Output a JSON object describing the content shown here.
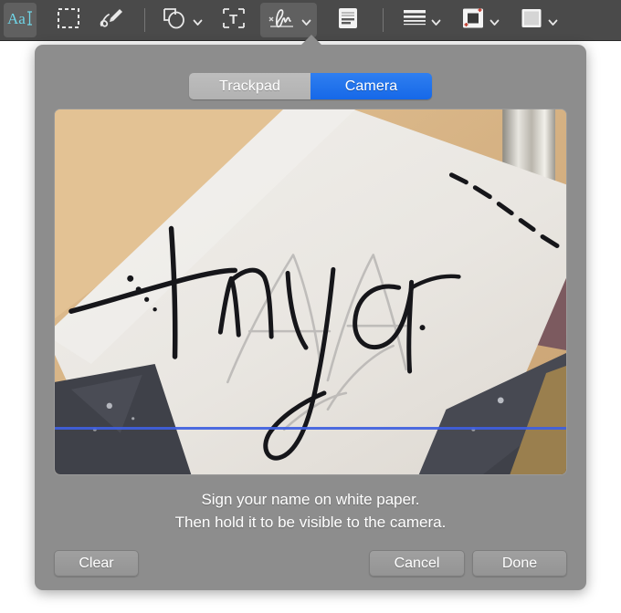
{
  "toolbar": {
    "items": [
      {
        "name": "text-selection-tool",
        "icon": "text-selection-icon",
        "label": "Aa",
        "active": true,
        "chevron": false
      },
      {
        "name": "rect-selection-tool",
        "icon": "marquee-selection-icon",
        "label": "",
        "active": false,
        "chevron": false
      },
      {
        "name": "sketch-tool",
        "icon": "sketch-pen-icon",
        "label": "",
        "active": false,
        "chevron": false
      },
      {
        "name": "shapes-tool",
        "icon": "shapes-icon",
        "label": "",
        "active": false,
        "chevron": true
      },
      {
        "name": "text-tool",
        "icon": "text-box-icon",
        "label": "",
        "active": false,
        "chevron": false
      },
      {
        "name": "signature-tool",
        "icon": "signature-icon",
        "label": "",
        "active": true,
        "chevron": true
      },
      {
        "name": "note-tool",
        "icon": "note-icon",
        "label": "",
        "active": false,
        "chevron": false
      },
      {
        "name": "stroke-weight-tool",
        "icon": "stroke-weight-icon",
        "label": "",
        "active": false,
        "chevron": true
      },
      {
        "name": "border-color-tool",
        "icon": "border-color-icon",
        "label": "",
        "active": false,
        "chevron": true
      },
      {
        "name": "fill-color-tool",
        "icon": "fill-color-icon",
        "label": "",
        "active": false,
        "chevron": true
      }
    ],
    "colors": {
      "background": "#4a4a4a",
      "active_tint": "#6fd6e8",
      "icon": "#e8e8e8",
      "border_accent": "#c0392b"
    }
  },
  "popover": {
    "title": "",
    "background_color": "#8d8d8d",
    "segmented_control": {
      "options": [
        "Trackpad",
        "Camera"
      ],
      "selected": "Camera",
      "selected_color": "#1f6fe5",
      "unselected_color": "#b8b8b8"
    },
    "camera": {
      "signature_text": "Anya",
      "baseline_color": "#3f5fe0",
      "paper_color": "#eae7e3",
      "surface_color": "#d8b98a"
    },
    "instructions": {
      "line1": "Sign your name on white paper.",
      "line2": "Then hold it to be visible to the camera."
    },
    "buttons": {
      "clear": "Clear",
      "cancel": "Cancel",
      "done": "Done"
    }
  }
}
